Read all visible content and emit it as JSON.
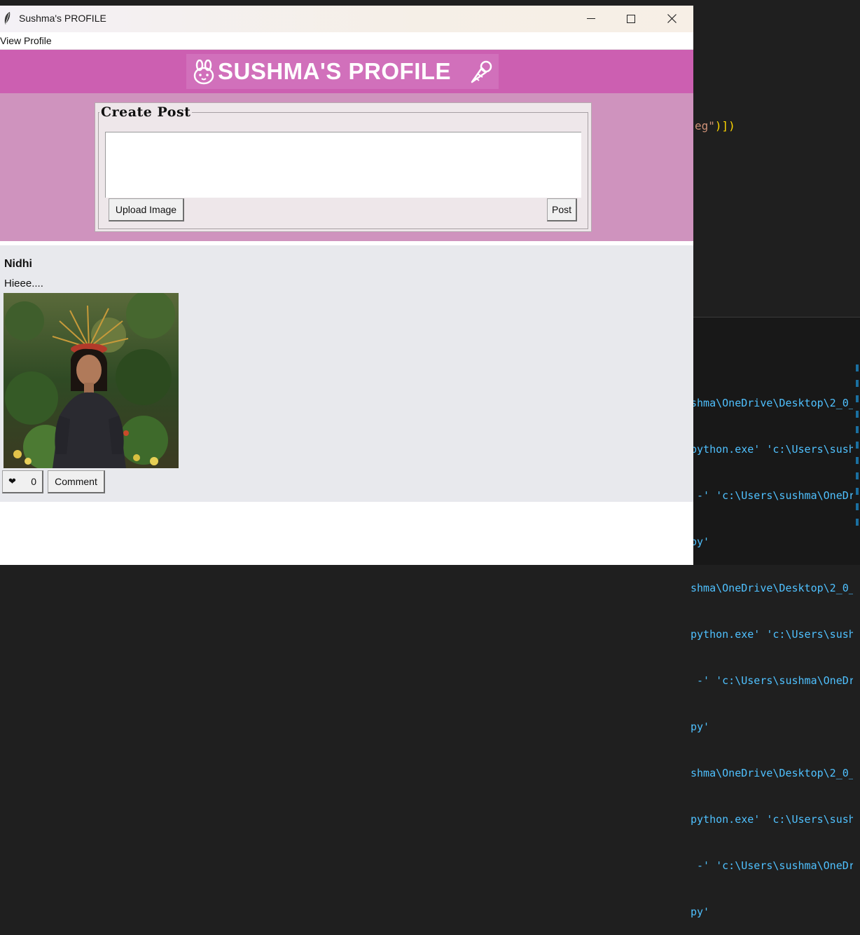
{
  "window": {
    "title": "Sushma's PROFILE"
  },
  "menu": {
    "items": [
      "View Profile"
    ]
  },
  "header": {
    "banner_text": "SUSHMA'S PROFILE",
    "left_icon": "bunny-icon",
    "right_icon": "ice-cream-icon",
    "bg_color": "#cc5fb1"
  },
  "create_post": {
    "title": "Create Post",
    "input_value": "",
    "upload_label": "Upload Image",
    "post_label": "Post",
    "panel_color": "#cf93be"
  },
  "feed": {
    "posts": [
      {
        "author": "Nidhi",
        "text": "Hieee....",
        "image_alt": "woman-with-headdress-in-garden-photo",
        "like_icon": "heart-icon",
        "like_count": "0",
        "comment_label": "Comment"
      }
    ]
  },
  "background_editor": {
    "code_fragment_string": "eg\"",
    "code_fragment_close": ")])",
    "terminal_lines": [
      "shma\\OneDrive\\Desktop\\2_0_",
      "python.exe' 'c:\\Users\\sush",
      " -' 'c:\\Users\\sushma\\OneDr",
      "py'",
      "shma\\OneDrive\\Desktop\\2_0_",
      "python.exe' 'c:\\Users\\sush",
      " -' 'c:\\Users\\sushma\\OneDr",
      "py'",
      "shma\\OneDrive\\Desktop\\2_0_",
      "python.exe' 'c:\\Users\\sush",
      " -' 'c:\\Users\\sushma\\OneDr",
      "py'"
    ]
  }
}
